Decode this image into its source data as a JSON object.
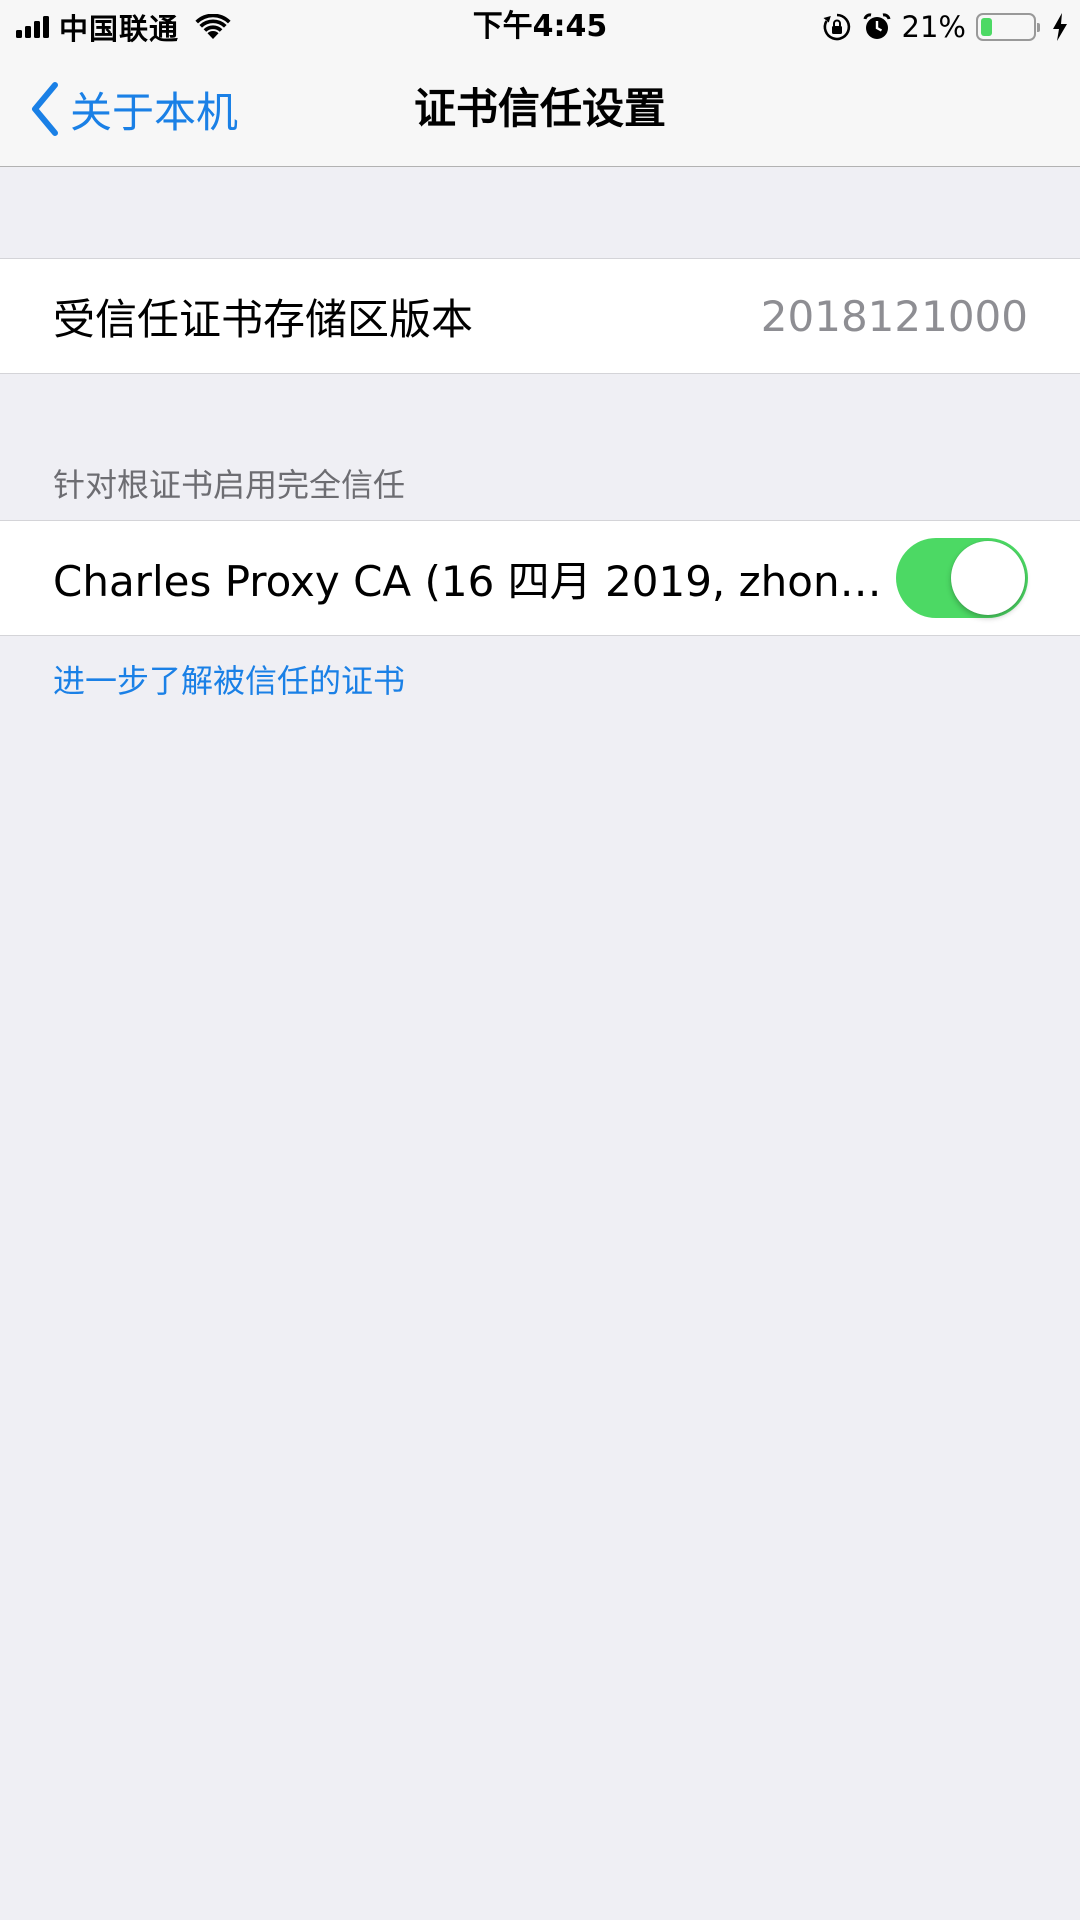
{
  "status_bar": {
    "carrier": "中国联通",
    "time": "下午4:45",
    "battery_percent": "21%",
    "battery_level": 0.21,
    "icons": [
      "signal-icon",
      "wifi-icon",
      "rotation-lock-icon",
      "alarm-icon",
      "battery-icon",
      "charging-icon"
    ]
  },
  "nav": {
    "back_label": "关于本机",
    "title": "证书信任设置"
  },
  "store_version": {
    "label": "受信任证书存储区版本",
    "value": "2018121000"
  },
  "root_trust": {
    "header": "针对根证书启用完全信任",
    "certificate": {
      "label": "Charles Proxy CA (16 四月 2019, zhonga…",
      "enabled": true
    },
    "learn_more": "进一步了解被信任的证书"
  },
  "colors": {
    "accent": "#1a80e6",
    "toggle_on": "#4cd964",
    "background": "#efeff4"
  }
}
